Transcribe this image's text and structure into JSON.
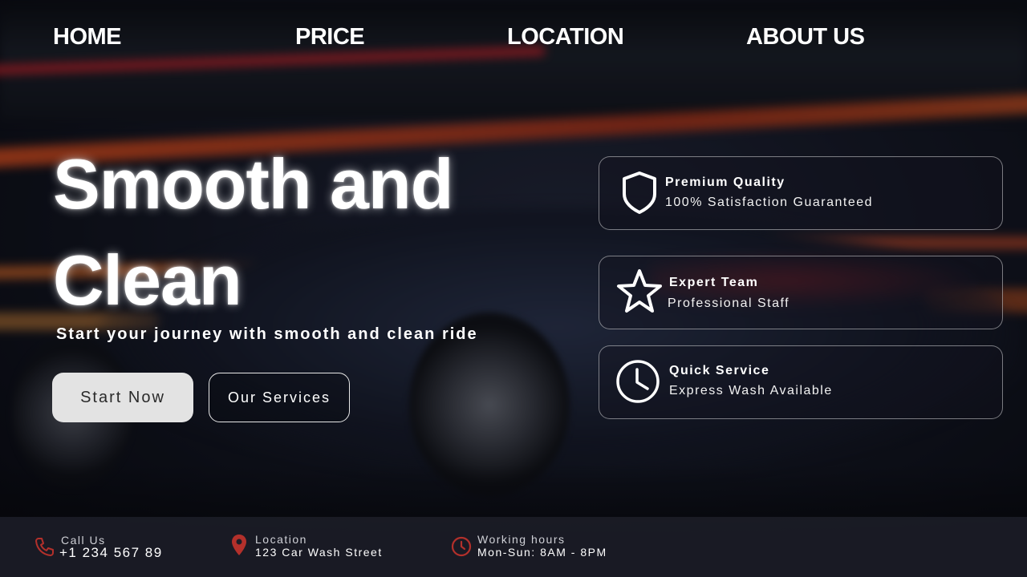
{
  "nav": {
    "items": [
      {
        "label": "HOME"
      },
      {
        "label": "PRICE"
      },
      {
        "label": "LOCATION"
      },
      {
        "label": "ABOUT US"
      }
    ]
  },
  "hero": {
    "title": "Smooth and Clean",
    "subtitle": "Start your journey with smooth and clean ride",
    "primary_button": "Start Now",
    "secondary_button": "Our Services"
  },
  "features": [
    {
      "icon": "shield-icon",
      "title": "Premium Quality",
      "description": "100% Satisfaction Guaranteed"
    },
    {
      "icon": "star-icon",
      "title": "Expert Team",
      "description": "Professional Staff"
    },
    {
      "icon": "clock-icon",
      "title": "Quick Service",
      "description": "Express Wash Available"
    }
  ],
  "footer": {
    "call": {
      "icon": "phone-icon",
      "label": "Call Us",
      "value": "+1 234 567 89"
    },
    "location": {
      "icon": "map-pin-icon",
      "label": "Location",
      "value": "123 Car Wash Street"
    },
    "hours": {
      "icon": "clock-icon",
      "label": "Working hours",
      "value": "Mon-Sun: 8AM - 8PM"
    }
  },
  "colors": {
    "accent": "#c0392b",
    "text": "#ffffff",
    "button_primary_bg": "#e3e3e3",
    "footer_bg": "#1c1e28"
  }
}
